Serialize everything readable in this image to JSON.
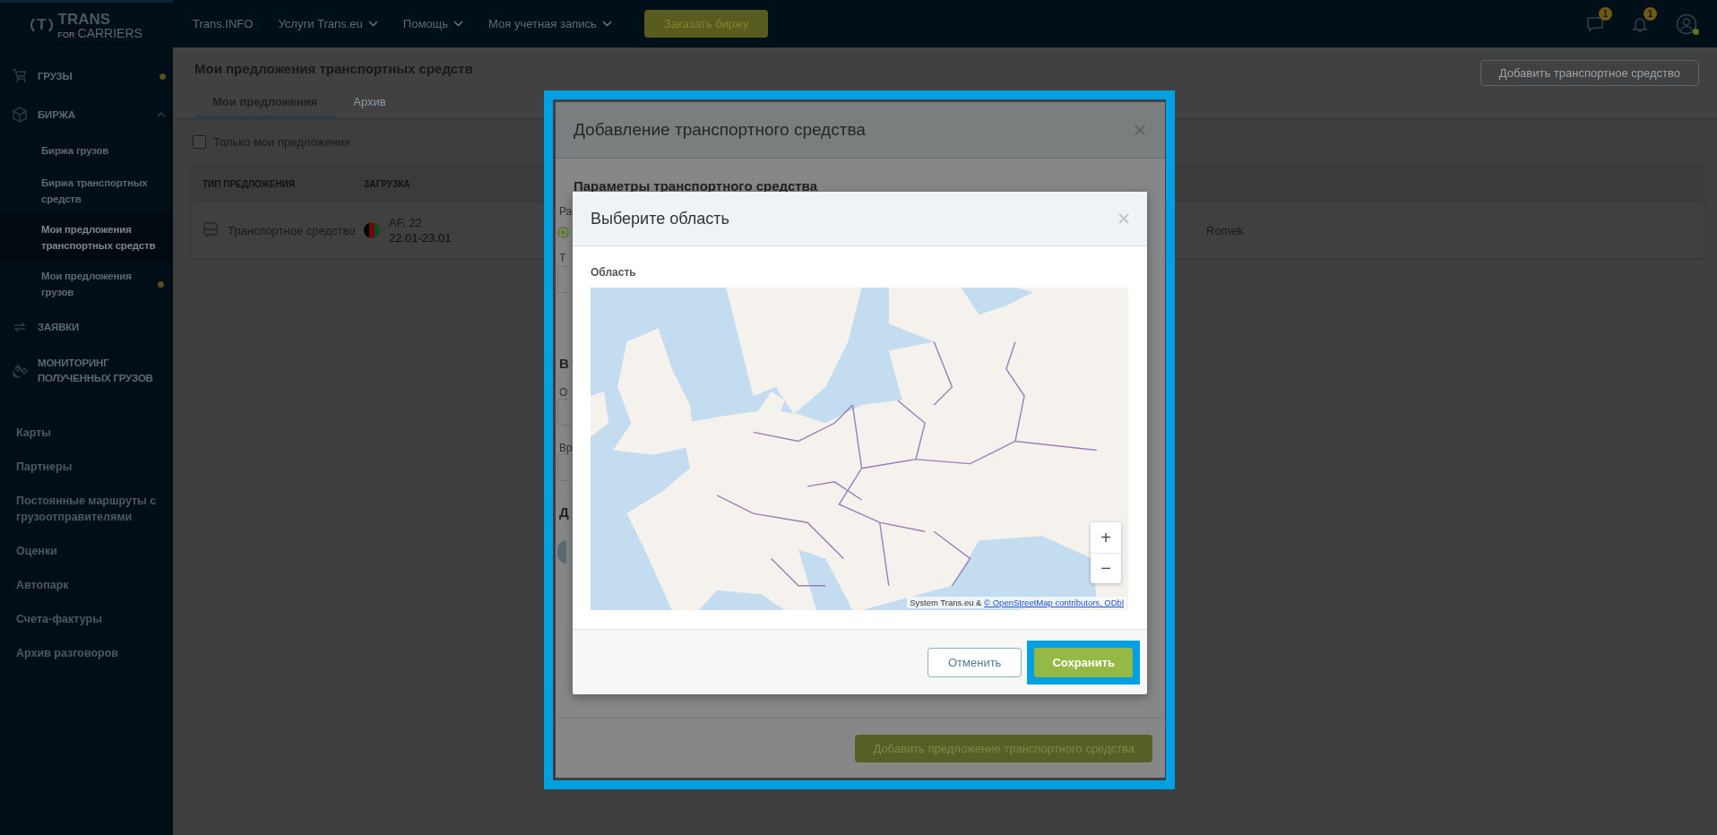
{
  "sidebar": {
    "logo": {
      "mark": "T",
      "word": "TRANS",
      "small": "FOR",
      "sub": "CARRIERS"
    },
    "items": [
      {
        "kind": "section",
        "label": "ГРУЗЫ",
        "dot": true
      },
      {
        "kind": "section",
        "label": "БИРЖА",
        "expanded": true,
        "children": [
          {
            "label": "Биржа грузов",
            "selected": false,
            "dot": false
          },
          {
            "label": "Биржа транспортных средств",
            "selected": false,
            "dot": false
          },
          {
            "label": "Мои предложения транспортных средств",
            "selected": true,
            "dot": false
          },
          {
            "label": "Мои предложения грузов",
            "selected": false,
            "dot": true
          }
        ]
      },
      {
        "kind": "section",
        "label": "ЗАЯВКИ",
        "dot": false
      },
      {
        "kind": "section",
        "label": "МОНИТОРИНГ ПОЛУЧЕННЫХ ГРУЗОВ",
        "dot": false
      },
      {
        "kind": "link",
        "label": "Карты"
      },
      {
        "kind": "link",
        "label": "Партнеры"
      },
      {
        "kind": "link",
        "label": "Постоянные маршруты с грузоотправителями"
      },
      {
        "kind": "link",
        "label": "Оценки"
      },
      {
        "kind": "link",
        "label": "Автопарк"
      },
      {
        "kind": "link",
        "label": "Счета-фактуры"
      },
      {
        "kind": "link",
        "label": "Архив разговоров"
      }
    ]
  },
  "topbar": {
    "nav": [
      {
        "label": "Trans.INFO",
        "dropdown": false
      },
      {
        "label": "Услуги Trans.eu",
        "dropdown": true
      },
      {
        "label": "Помощь",
        "dropdown": true
      },
      {
        "label": "Моя учетная запись",
        "dropdown": true
      }
    ],
    "order_button": "Заказать биржу",
    "icons": [
      {
        "kind": "chat",
        "badge": "1"
      },
      {
        "kind": "bell",
        "badge": "1"
      },
      {
        "kind": "avatar",
        "online": true
      }
    ]
  },
  "page": {
    "title": "Мои предложения транспортных средств",
    "add_button": "Добавить транспортное средство",
    "tabs": [
      {
        "label": "Мои предложения",
        "selected": true
      },
      {
        "label": "Архив",
        "selected": false
      }
    ],
    "filter": {
      "label": "Только мои предложения",
      "checked": false
    },
    "table": {
      "columns": [
        "ТИП ПРЕДЛОЖЕНИЯ",
        "ЗАГРУЗКА"
      ],
      "rows": [
        {
          "type": "Транспортное средство",
          "place": "AF, 22",
          "dates": "22.01-23.01",
          "contact": "Romek"
        }
      ]
    }
  },
  "vehicle_dialog": {
    "title": "Добавление транспортного средства",
    "section": "Параметры транспортного средства",
    "fragments": [
      "Ра",
      "Т",
      "В",
      "О",
      "Вр",
      "Д"
    ],
    "radio_checked": true,
    "submit_button": "Добавить предложение транспортного средства"
  },
  "area_dialog": {
    "title": "Выберите область",
    "field_label": "Область",
    "map": {
      "kind": "picture",
      "zoom_in": "+",
      "zoom_out": "−",
      "attribution": "System Trans.eu & ",
      "attribution_link": "© OpenStreetMap contributors, ODbl"
    },
    "cancel_button": "Отменить",
    "save_button": "Сохранить",
    "save_highlighted": true
  }
}
